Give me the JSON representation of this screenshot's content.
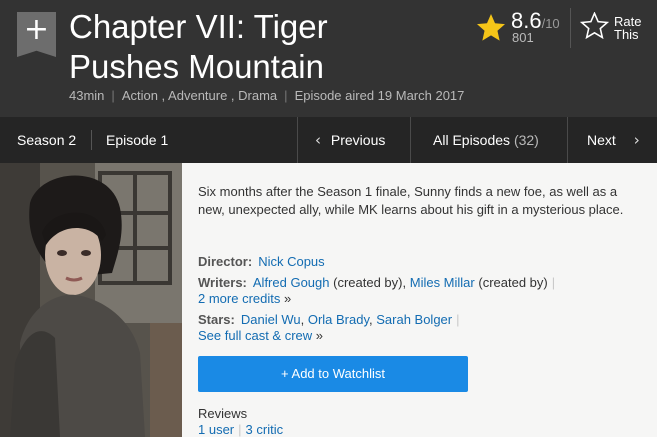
{
  "header": {
    "add_icon": "plus-icon",
    "add_glyph": "+",
    "title": "Chapter VII: Tiger Pushes Mountain",
    "runtime": "43min",
    "genres": "Action , Adventure , Drama",
    "aired": "Episode aired 19 March 2017",
    "rating": {
      "value": "8.6",
      "max": "/10",
      "count": "801",
      "star_color": "#f5c518"
    },
    "rate_label": "Rate This"
  },
  "subnav": {
    "season": "Season 2",
    "episode": "Episode 1",
    "previous": "Previous",
    "all_episodes": "All Episodes",
    "all_episodes_count": "(32)",
    "next": "Next",
    "chevron_left": "‹",
    "chevron_right": "›"
  },
  "main": {
    "plot": "Six months after the Season 1 finale, Sunny finds a new foe, as well as a new, unexpected ally, while MK learns about his gift in a mysterious place.",
    "director_label": "Director:",
    "director": "Nick Copus",
    "writers_label": "Writers:",
    "writer1": "Alfred Gough",
    "writer1_note": "(created by),",
    "writer2": "Miles Millar",
    "writer2_note": "(created by)",
    "more_credits": "2 more credits",
    "more_credits_arrow": "»",
    "stars_label": "Stars:",
    "star1": "Daniel Wu",
    "star2": "Orla Brady",
    "star3": "Sarah Bolger",
    "full_cast": "See full cast & crew",
    "full_cast_arrow": "»",
    "watchlist": "+  Add to Watchlist",
    "reviews_label": "Reviews",
    "user_reviews": "1 user",
    "critic_reviews": "3 critic"
  }
}
